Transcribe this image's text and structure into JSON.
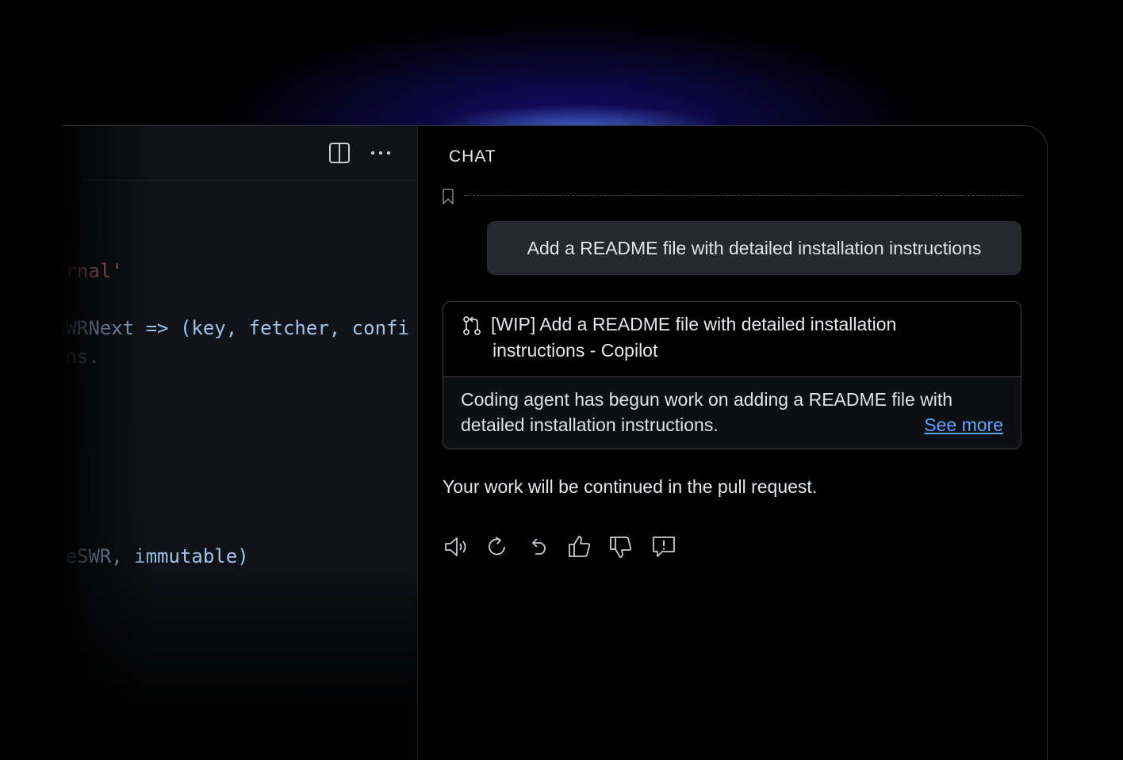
{
  "editor": {
    "code_lines": [
      {
        "text": "ernal'",
        "color": "#c97e6a"
      },
      {
        "text": "SWRNext => (key, fetcher, confi",
        "color": "#9fc4e8"
      },
      {
        "text": "ons.",
        "color": "#7d8790"
      },
      {
        "text": ")",
        "color": "#7d8790"
      },
      {
        "text": "seSWR, immutable)",
        "color": "#9fc4e8"
      }
    ]
  },
  "chat": {
    "title": "CHAT",
    "user_message": "Add a README file with detailed installation instructions",
    "pr_card": {
      "title_line1": "[WIP] Add a README file with detailed installation",
      "title_line2": "instructions - Copilot",
      "description": "Coding agent has begun work on adding a README file with detailed installation instructions.",
      "link": "See more"
    },
    "response": "Your work will be continued in the pull request.",
    "actions": [
      {
        "name": "read-aloud-icon"
      },
      {
        "name": "retry-icon"
      },
      {
        "name": "undo-icon"
      },
      {
        "name": "thumbs-up-icon"
      },
      {
        "name": "thumbs-down-icon"
      },
      {
        "name": "report-icon"
      }
    ]
  },
  "colors": {
    "accent_link": "#5ca5ff",
    "user_bubble": "#25282d",
    "background": "#000000"
  }
}
